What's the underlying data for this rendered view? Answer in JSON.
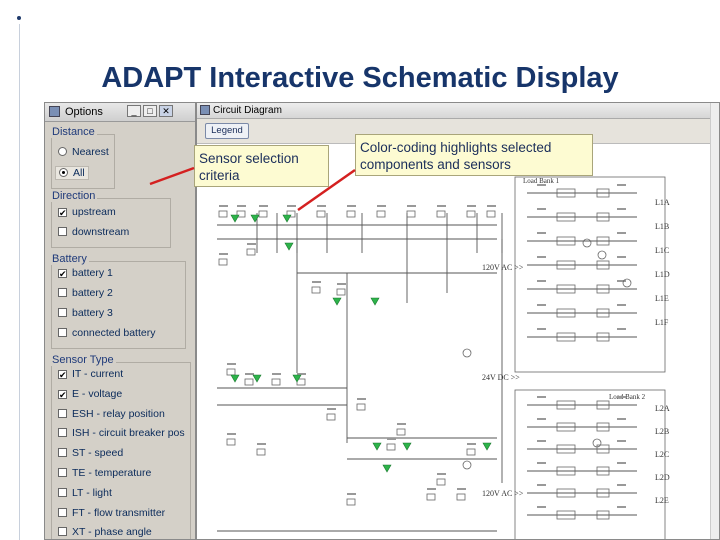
{
  "slide": {
    "title": "ADAPT Interactive Schematic Display"
  },
  "options_window": {
    "title": "Options",
    "groups": [
      {
        "title": "Distance",
        "items": [
          {
            "label": "Nearest",
            "kind": "radio",
            "checked": false
          },
          {
            "label": "All",
            "kind": "radio",
            "checked": true
          }
        ]
      },
      {
        "title": "Direction",
        "items": [
          {
            "label": "upstream",
            "kind": "check",
            "checked": true
          },
          {
            "label": "downstream",
            "kind": "check",
            "checked": false
          }
        ]
      },
      {
        "title": "Battery",
        "items": [
          {
            "label": "battery 1",
            "kind": "check",
            "checked": true
          },
          {
            "label": "battery 2",
            "kind": "check",
            "checked": false
          },
          {
            "label": "battery 3",
            "kind": "check",
            "checked": false
          },
          {
            "label": "connected battery",
            "kind": "check",
            "checked": false
          }
        ]
      },
      {
        "title": "Sensor Type",
        "items": [
          {
            "label": "IT - current",
            "kind": "check",
            "checked": true
          },
          {
            "label": "E - voltage",
            "kind": "check",
            "checked": true
          },
          {
            "label": "ESH - relay position",
            "kind": "check",
            "checked": false
          },
          {
            "label": "ISH - circuit breaker pos",
            "kind": "check",
            "checked": false
          },
          {
            "label": "ST - speed",
            "kind": "check",
            "checked": false
          },
          {
            "label": "TE - temperature",
            "kind": "check",
            "checked": false
          },
          {
            "label": "LT - light",
            "kind": "check",
            "checked": false
          },
          {
            "label": "FT - flow transmitter",
            "kind": "check",
            "checked": false
          },
          {
            "label": "XT - phase angle",
            "kind": "check",
            "checked": false
          }
        ]
      }
    ]
  },
  "circuit_window": {
    "title": "Circuit Diagram",
    "legend_button": "Legend",
    "labels": {
      "load_bank_1": "Load Bank 1",
      "load_bank_2": "Load Bank 2",
      "ac_24v_1": "120V AC >>",
      "dc_24v": "24V DC >>",
      "ac_24v_2": "120V AC >>",
      "l1a": "L1A",
      "l1b": "L1B",
      "l1c": "L1C",
      "l1d": "L1D",
      "l1e": "L1E",
      "l1f": "L1F",
      "l2a": "L2A",
      "l2b": "L2B",
      "l2c": "L2C",
      "l2d": "L2D",
      "l2e": "L2E"
    }
  },
  "callouts": {
    "sensor": "Sensor selection criteria",
    "color": "Color-coding highlights selected components and sensors"
  },
  "colors": {
    "title": "#17356a",
    "highlight": "#2db34a",
    "arrow": "#d42020",
    "callout_bg": "#fdfbd2"
  }
}
